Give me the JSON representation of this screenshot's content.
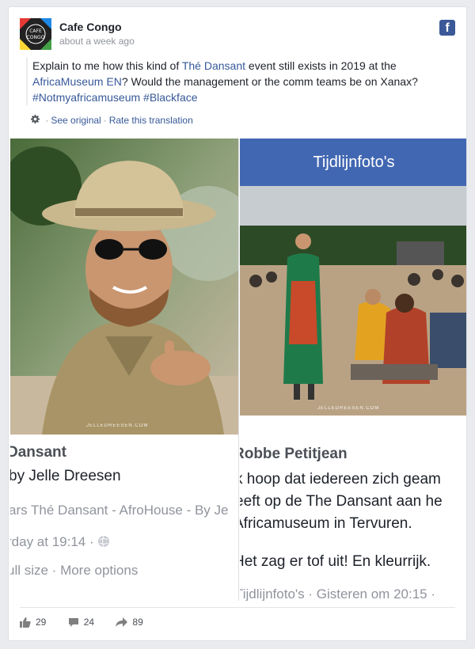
{
  "page": {
    "name": "Cafe Congo",
    "time": "about a week ago",
    "fb_glyph": "f"
  },
  "avatar": {
    "line1": "CAFE",
    "line2": "CONGO"
  },
  "post": {
    "t1": "Explain to me how this kind of ",
    "link1": "Thé Dansant",
    "t2": " event still exists in 2019 at the ",
    "link2": "AfricaMuseum EN",
    "t3": "? Would the management or the comm teams be on Xanax?",
    "hashtags": "#Notmyafricamuseum #Blackface"
  },
  "translation": {
    "see_original": "See original",
    "rate": "Rate this translation"
  },
  "left_share": {
    "watermark": "JELLEDREESEN.COM",
    "title": "Dansant",
    "by": "by Jelle Dreesen",
    "album": "ars Thé Dansant - AfroHouse - By Je",
    "time": "rday at 19:14 ·",
    "actions": "ull size · More options"
  },
  "right_share": {
    "band": "Tijdlijnfoto's",
    "watermark": "JELLEDREESEN.COM",
    "author": "Robbe Petitjean",
    "l1": "k hoop dat iedereen zich geam",
    "l2": "eeft op de The Dansant aan he",
    "l3": "Africamuseum in Tervuren.",
    "l4": "Het zag er tof uit! En kleurrijk.",
    "meta": "Tijdlijnfoto's · Gisteren om 20:15 ·"
  },
  "reactions": {
    "likes": "29",
    "comments": "24",
    "shares": "89"
  },
  "colors": {
    "fb_blue": "#3b5998",
    "link": "#365899",
    "band": "#4267b2"
  },
  "icons": [
    "facebook-icon",
    "gear-icon",
    "globe-icon",
    "like-icon",
    "comment-icon",
    "share-icon"
  ]
}
